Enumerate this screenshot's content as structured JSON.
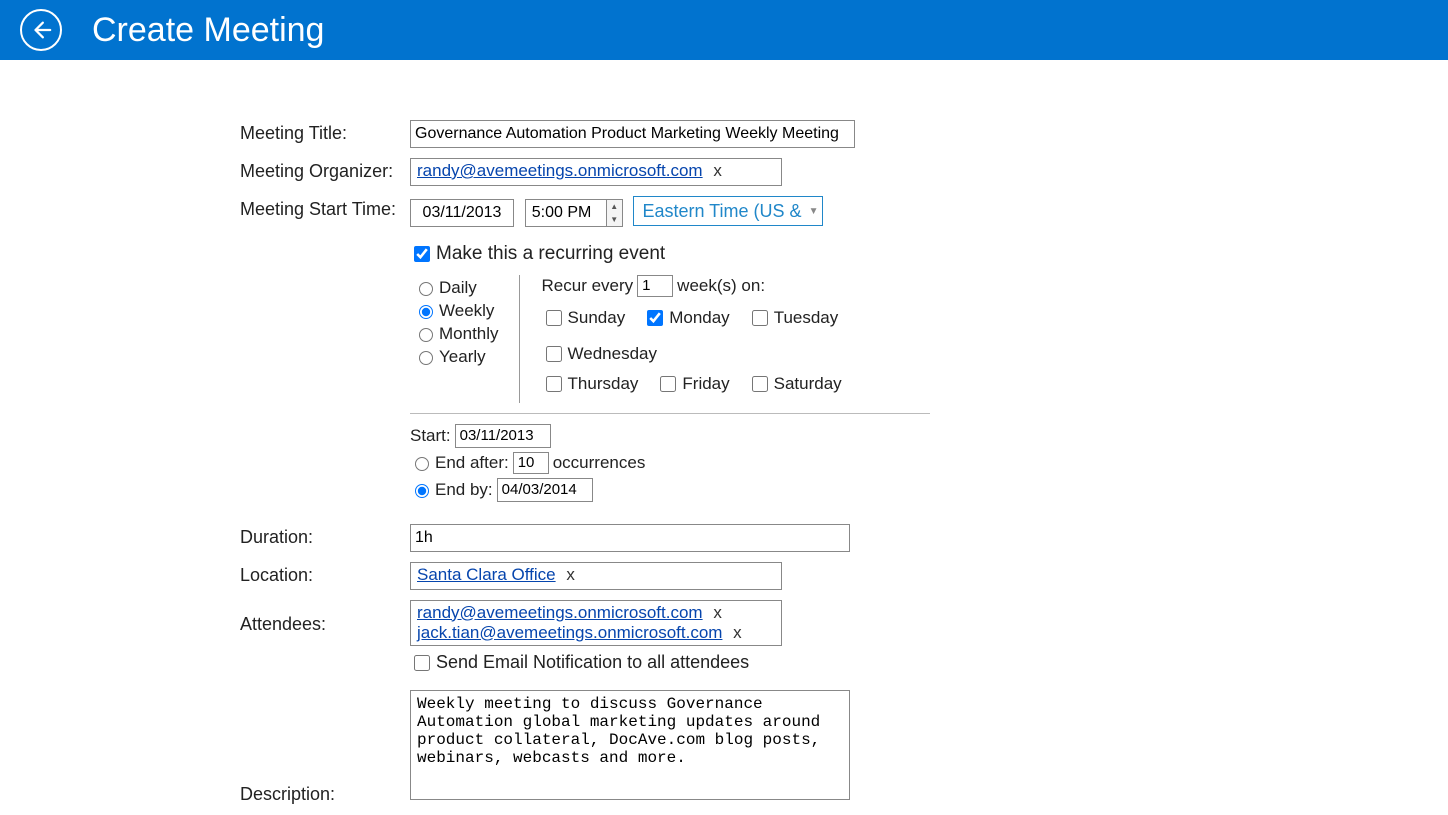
{
  "header": {
    "title": "Create Meeting"
  },
  "labels": {
    "meeting_title": "Meeting Title:",
    "meeting_organizer": "Meeting Organizer:",
    "meeting_start": "Meeting Start Time:",
    "duration": "Duration:",
    "location": "Location:",
    "attendees": "Attendees:",
    "description": "Description:"
  },
  "meeting": {
    "title": "Governance Automation Product Marketing Weekly Meeting",
    "organizer": "randy@avemeetings.onmicrosoft.com",
    "start_date": "03/11/2013",
    "start_time": "5:00 PM",
    "timezone": "Eastern Time (US &",
    "duration": "1h",
    "location": "Santa Clara Office",
    "attendees": [
      "randy@avemeetings.onmicrosoft.com",
      "jack.tian@avemeetings.onmicrosoft.com"
    ],
    "description": "Weekly meeting to discuss Governance Automation global marketing updates around product collateral, DocAve.com blog posts, webinars, webcasts and more."
  },
  "recurring": {
    "make_recurring_label": "Make this a recurring event",
    "make_recurring_checked": true,
    "freq": {
      "daily": "Daily",
      "weekly": "Weekly",
      "monthly": "Monthly",
      "yearly": "Yearly",
      "selected": "weekly"
    },
    "recur_every_prefix": "Recur every",
    "recur_every_value": "1",
    "recur_every_suffix": "week(s) on:",
    "days": {
      "sunday": {
        "label": "Sunday",
        "checked": false
      },
      "monday": {
        "label": "Monday",
        "checked": true
      },
      "tuesday": {
        "label": "Tuesday",
        "checked": false
      },
      "wednesday": {
        "label": "Wednesday",
        "checked": false
      },
      "thursday": {
        "label": "Thursday",
        "checked": false
      },
      "friday": {
        "label": "Friday",
        "checked": false
      },
      "saturday": {
        "label": "Saturday",
        "checked": false
      }
    },
    "range": {
      "start_label": "Start:",
      "start_date": "03/11/2013",
      "end_after_label": "End after:",
      "end_after_value": "10",
      "occurrences_label": "occurrences",
      "end_by_label": "End by:",
      "end_by_date": "04/03/2014",
      "selected": "end_by"
    }
  },
  "notify": {
    "label": "Send Email Notification to all attendees",
    "checked": false
  },
  "remove_x": "x"
}
